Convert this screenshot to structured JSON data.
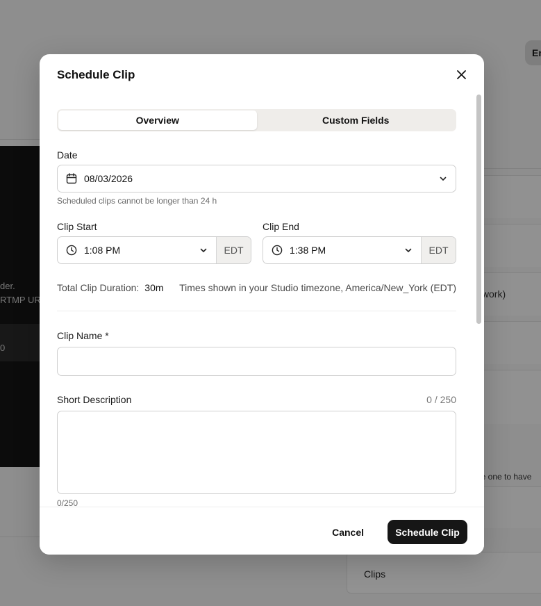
{
  "background": {
    "panel_text_1": "der.",
    "panel_text_2": "RTMP UR",
    "panel_text_3": "0",
    "top_right_pill": "En",
    "right_label_network": "twork)",
    "right_label_schedule": "le one to have",
    "clips_card_label": "Clips"
  },
  "modal": {
    "title": "Schedule Clip",
    "tabs": [
      {
        "label": "Overview",
        "active": true
      },
      {
        "label": "Custom Fields",
        "active": false
      }
    ],
    "date": {
      "label": "Date",
      "value": "08/03/2026",
      "hint": "Scheduled clips cannot be longer than 24 h"
    },
    "clip_start": {
      "label": "Clip Start",
      "value": "1:08 PM",
      "timezone": "EDT"
    },
    "clip_end": {
      "label": "Clip End",
      "value": "1:38 PM",
      "timezone": "EDT"
    },
    "duration": {
      "label": "Total Clip Duration:",
      "value": "30m",
      "timezone_note": "Times shown in your Studio timezone, America/New_York (EDT)"
    },
    "clip_name": {
      "label": "Clip Name *",
      "value": "",
      "placeholder": ""
    },
    "short_description": {
      "label": "Short Description",
      "counter": "0 / 250",
      "value": "",
      "footer_counter": "0/250"
    },
    "footer": {
      "cancel_label": "Cancel",
      "submit_label": "Schedule Clip"
    }
  },
  "icons": {
    "close": "close-icon",
    "calendar": "calendar-icon",
    "clock": "clock-icon",
    "chevron": "chevron-down-icon"
  },
  "colors": {
    "primary_button": "#161616",
    "tab_track": "#efedea",
    "overlay": "rgba(0,0,0,0.42)"
  }
}
